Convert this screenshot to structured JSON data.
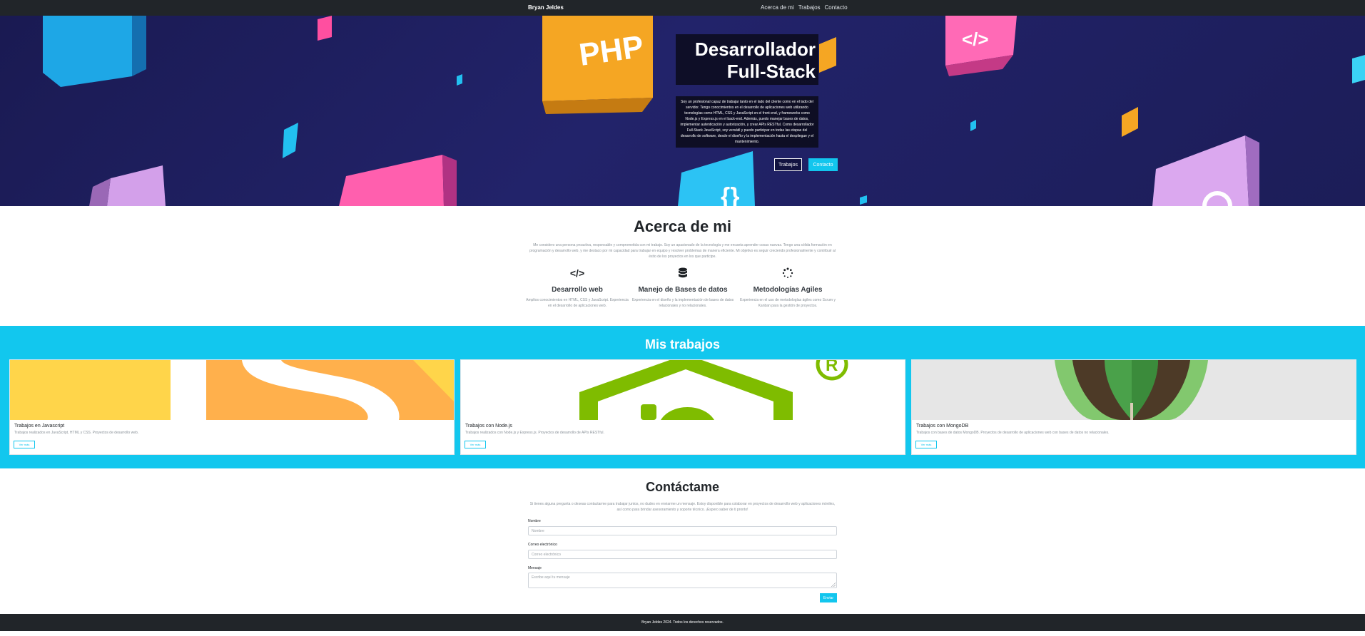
{
  "navbar": {
    "brand": "Bryan Jeldes",
    "links": [
      "Acerca de mi",
      "Trabajos",
      "Contacto"
    ]
  },
  "hero": {
    "title_line1": "Desarrollador",
    "title_line2": "Full-Stack",
    "description": "Soy un profesional capaz de trabajar tanto en el lado del cliente como en el lado del servidor. Tengo conocimientos en el desarrollo de aplicaciones web utilizando tecnologías como HTML, CSS y JavaScript en el front-end, y frameworks como Node.js y Express.js en el back-end. Además, puedo manejar bases de datos, implementar autenticación y autorización, y crear APIs RESTful. Como desarrollador Full-Stack JavaScript, soy versátil y puedo participar en todas las etapas del desarrollo de software, desde el diseño y la implementación hasta el despliegue y el mantenimiento.",
    "badge_php": "PHP",
    "badge_tag": "</>",
    "badge_braces": "{}",
    "btn_works": "Trabajos",
    "btn_contact": "Contacto"
  },
  "about": {
    "title": "Acerca de mi",
    "text": "Me considero una persona proactiva, responsable y comprometida con mi trabajo. Soy un apasionado de la tecnología y me encanta aprender cosas nuevas. Tengo una sólida formación en programación y desarrollo web, y me destaco por mi capacidad para trabajar en equipo y resolver problemas de manera eficiente. Mi objetivo es seguir creciendo profesionalmente y contribuir al éxito de los proyectos en los que participe.",
    "features": [
      {
        "icon": "code-icon",
        "glyph": "</>",
        "title": "Desarrollo web",
        "text": "Amplios conocimientos en HTML, CSS y JavaScript. Experiencia en el desarrollo de aplicaciones web."
      },
      {
        "icon": "database-icon",
        "glyph": "",
        "title": "Manejo de Bases de datos",
        "text": "Experiencia en el diseño y la implementación de bases de datos relacionales y no relacionales."
      },
      {
        "icon": "spinner-icon",
        "glyph": "",
        "title": "Metodologías Agiles",
        "text": "Experiencia en el uso de metodologías ágiles como Scrum y Kanban para la gestión de proyectos."
      }
    ]
  },
  "works": {
    "title": "Mis trabajos",
    "cards": [
      {
        "title": "Trabajos en Javascript",
        "text": "Trabajos realizados en JavaScript, HTML y CSS. Proyectos de desarrollo web.",
        "button": "Ver más"
      },
      {
        "title": "Trabajos con Node.js",
        "text": "Trabajos realizados con Node.js y Express.js. Proyectos de desarrollo de APIs RESTful.",
        "button": "Ver más"
      },
      {
        "title": "Trabajos con MongoDB",
        "text": "Trabajos con bases de datos MongoDB. Proyectos de desarrollo de aplicaciones web con bases de datos no relacionales.",
        "button": "Ver más"
      }
    ]
  },
  "contact": {
    "title": "Contáctame",
    "text": "Si tienes alguna pregunta o deseas contactarme para trabajar juntos, no dudes en enviarme un mensaje. Estoy disponible para colaborar en proyectos de desarrollo web y aplicaciones móviles, así como para brindar asesoramiento y soporte técnico. ¡Espero saber de ti pronto!",
    "name_label": "Nombre",
    "name_placeholder": "Nombre",
    "email_label": "Correo electrónico",
    "email_placeholder": "Correo electrónico",
    "message_label": "Mensaje",
    "message_placeholder": "Escribe aquí tu mensaje",
    "send_button": "Enviar"
  },
  "footer": {
    "text": "Bryan Jeldes 2024. Todos los derechos reservados."
  },
  "colors": {
    "accent": "#12c6ee",
    "dark": "#212529",
    "hero_bg": "#1e1f5e"
  }
}
